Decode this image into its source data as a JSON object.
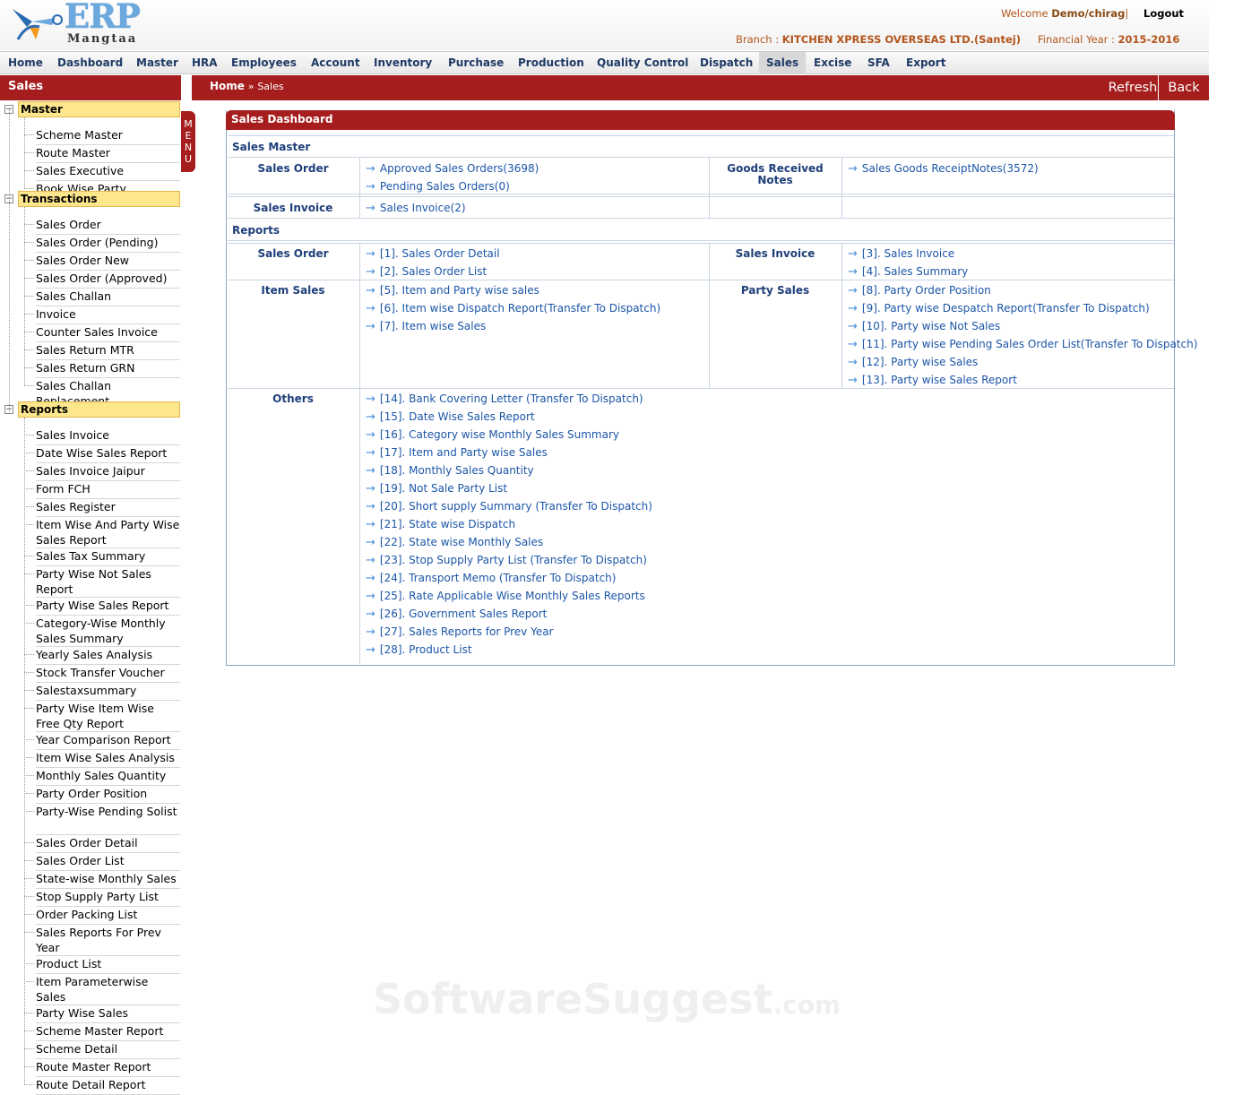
{
  "header": {
    "logo_text": "ERP",
    "logo_sub": "Mangtaa",
    "welcome_label": "Welcome",
    "user": "Demo/chirag",
    "sep": "|",
    "logout": "Logout",
    "branch_label": "Branch :",
    "branch": "KITCHEN XPRESS OVERSEAS LTD.(Santej)",
    "fy_label": "Financial Year :",
    "fy": "2015-2016"
  },
  "nav": [
    "Home",
    "Dashboard",
    "Master",
    "HRA",
    "Employees",
    "Account",
    "Inventory",
    "Purchase",
    "Production",
    "Quality Control",
    "Dispatch",
    "Sales",
    "Excise",
    "SFA",
    "Export"
  ],
  "sidebar": {
    "title": "Sales",
    "menu_tab": "MENU",
    "master": {
      "label": "Master",
      "items": [
        "Scheme Master",
        "Route Master",
        "Sales Executive",
        "Book Wise Party"
      ]
    },
    "transactions": {
      "label": "Transactions",
      "items": [
        "Sales Order",
        "Sales Order (Pending)",
        "Sales Order New",
        "Sales Order (Approved)",
        "Sales Challan",
        "Invoice",
        "Counter Sales Invoice",
        "Sales Return MTR",
        "Sales Return GRN",
        "Sales Challan Replacement"
      ]
    },
    "reports": {
      "label": "Reports",
      "items": [
        "Sales Invoice",
        "Date Wise Sales Report",
        "Sales Invoice Jaipur",
        "Form FCH",
        "Sales Register",
        "Item Wise And Party Wise Sales Report",
        "Sales Tax Summary",
        "Party Wise Not Sales Report",
        "Party Wise Sales Report",
        "Category-Wise Monthly Sales Summary",
        "Yearly Sales Analysis",
        "Stock Transfer Voucher",
        "Salestaxsummary",
        "Party Wise Item Wise Free Qty Report",
        "Year Comparison Report",
        "Item Wise Sales Analysis",
        "Monthly Sales Quantity",
        "Party Order Position",
        "Party-Wise Pending Solist",
        "Sales Order Detail",
        "Sales Order List",
        "State-wise Monthly Sales",
        "Stop Supply Party List",
        "Order Packing List",
        "Sales Reports For Prev Year",
        "Product List",
        "Item Parameterwise Sales",
        "Party Wise Sales",
        "Scheme Master Report",
        "Scheme Detail",
        "Route Master Report",
        "Route Detail Report"
      ]
    }
  },
  "breadcrumb": {
    "home": "Home",
    "sep": "»",
    "current": "Sales",
    "refresh": "Refresh",
    "back": "Back"
  },
  "dashboard": {
    "title": "Sales Dashboard",
    "sales_master": "Sales Master",
    "reports": "Reports",
    "sales_order_cat": "Sales Order",
    "grn_cat": "Goods Received Notes",
    "sales_invoice_cat": "Sales Invoice",
    "approved": "Approved Sales Orders(3698)",
    "pending": "Pending Sales Orders(0)",
    "grn": "Sales Goods ReceiptNotes(3572)",
    "invoice": "Sales Invoice(2)",
    "r_sales_order": "Sales Order",
    "r_sales_invoice": "Sales Invoice",
    "r_item_sales": "Item Sales",
    "r_party_sales": "Party Sales",
    "r_others": "Others",
    "so_links": [
      "[1]. Sales Order Detail",
      "[2]. Sales Order List"
    ],
    "si_links": [
      "[3]. Sales Invoice",
      "[4]. Sales Summary"
    ],
    "item_links": [
      "[5]. Item and Party wise sales",
      "[6]. Item wise Dispatch Report(Transfer To Dispatch)",
      "[7]. Item wise Sales"
    ],
    "party_links": [
      "[8]. Party Order Position",
      "[9]. Party wise Despatch Report(Transfer To Dispatch)",
      "[10]. Party wise Not Sales",
      "[11]. Party wise Pending Sales Order List(Transfer To Dispatch)",
      "[12]. Party wise Sales",
      "[13]. Party wise Sales Report"
    ],
    "other_links": [
      "[14]. Bank Covering Letter (Transfer To Dispatch)",
      "[15]. Date Wise Sales Report",
      "[16]. Category wise Monthly Sales Summary",
      "[17]. Item and Party wise Sales",
      "[18]. Monthly Sales Quantity",
      "[19]. Not Sale Party List",
      "[20]. Short supply Summary (Transfer To Dispatch)",
      "[21]. State wise Dispatch",
      "[22]. State wise Monthly Sales",
      "[23]. Stop Supply Party List (Transfer To Dispatch)",
      "[24]. Transport Memo (Transfer To Dispatch)",
      "[25]. Rate Applicable Wise Monthly Sales Reports",
      "[26]. Government Sales Report",
      "[27]. Sales Reports for Prev Year",
      "[28]. Product List"
    ]
  },
  "watermark": {
    "main": "SoftwareSuggest",
    "suffix": ".com"
  }
}
